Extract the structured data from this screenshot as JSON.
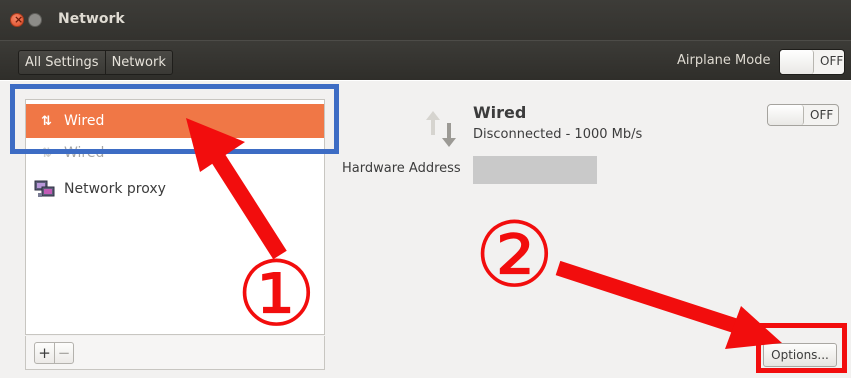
{
  "window": {
    "title": "Network"
  },
  "toolbar": {
    "breadcrumbs": [
      "All Settings",
      "Network"
    ],
    "airplane_mode_label": "Airplane Mode",
    "airplane_mode_state": "OFF"
  },
  "device_list": {
    "items": [
      {
        "label": "Wired",
        "icon": "wired-arrows-icon",
        "selected": true
      },
      {
        "label": "Wired",
        "icon": "wired-arrows-icon",
        "selected": false
      },
      {
        "label": "Network proxy",
        "icon": "network-proxy-icon",
        "selected": false
      }
    ],
    "add_label": "+",
    "remove_label": "−"
  },
  "detail": {
    "title": "Wired",
    "status": "Disconnected - 1000 Mb/s",
    "hardware_address_label": "Hardware Address",
    "hardware_address_value": "",
    "toggle_state": "OFF",
    "options_label": "Options..."
  },
  "annotations": {
    "marker_1": "①",
    "marker_2": "②",
    "highlight_color_blue": "#3d6cc4",
    "highlight_color_red": "#f20d0d"
  },
  "colors": {
    "selection": "#f07746",
    "titlebar": "#3c3b37"
  }
}
